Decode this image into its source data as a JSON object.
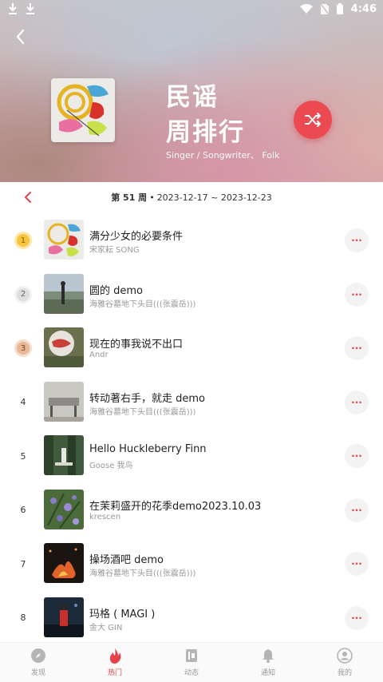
{
  "status_bar": {
    "time": "4:46"
  },
  "header": {
    "title_line1": "民谣",
    "title_line2": "周排行",
    "tags": "Singer / Songwriter、 Folk"
  },
  "week": {
    "label": "第 51 周",
    "separator": "•",
    "range": "2023-12-17 ~ 2023-12-23"
  },
  "colors": {
    "accent": "#e4434b",
    "shuffle_bg": "#ec4a52"
  },
  "songs": [
    {
      "rank": "1",
      "title": "满分少女的必要条件",
      "artist": "宋家耘 SONG"
    },
    {
      "rank": "2",
      "title": "圆的 demo",
      "artist": "海雅谷墓地下头目(((张震岳)))"
    },
    {
      "rank": "3",
      "title": "现在的事我说不出口",
      "artist": "Andr"
    },
    {
      "rank": "4",
      "title": "转动著右手，就走 demo",
      "artist": "海雅谷墓地下头目(((张震岳)))"
    },
    {
      "rank": "5",
      "title": "Hello Huckleberry Finn",
      "artist": "Goose 我鸟"
    },
    {
      "rank": "6",
      "title": "在茉莉盛开的花季demo2023.10.03",
      "artist": "krescen"
    },
    {
      "rank": "7",
      "title": "操场酒吧 demo",
      "artist": "海雅谷墓地下头目(((张震岳)))"
    },
    {
      "rank": "8",
      "title": "玛格 ( MAGI )",
      "artist": "金大 GIN"
    }
  ],
  "more_label": "···",
  "nav": [
    {
      "label": "发现",
      "icon": "compass-icon"
    },
    {
      "label": "热门",
      "icon": "flame-icon"
    },
    {
      "label": "动态",
      "icon": "feed-icon"
    },
    {
      "label": "通知",
      "icon": "bell-icon"
    },
    {
      "label": "我的",
      "icon": "profile-icon"
    }
  ]
}
